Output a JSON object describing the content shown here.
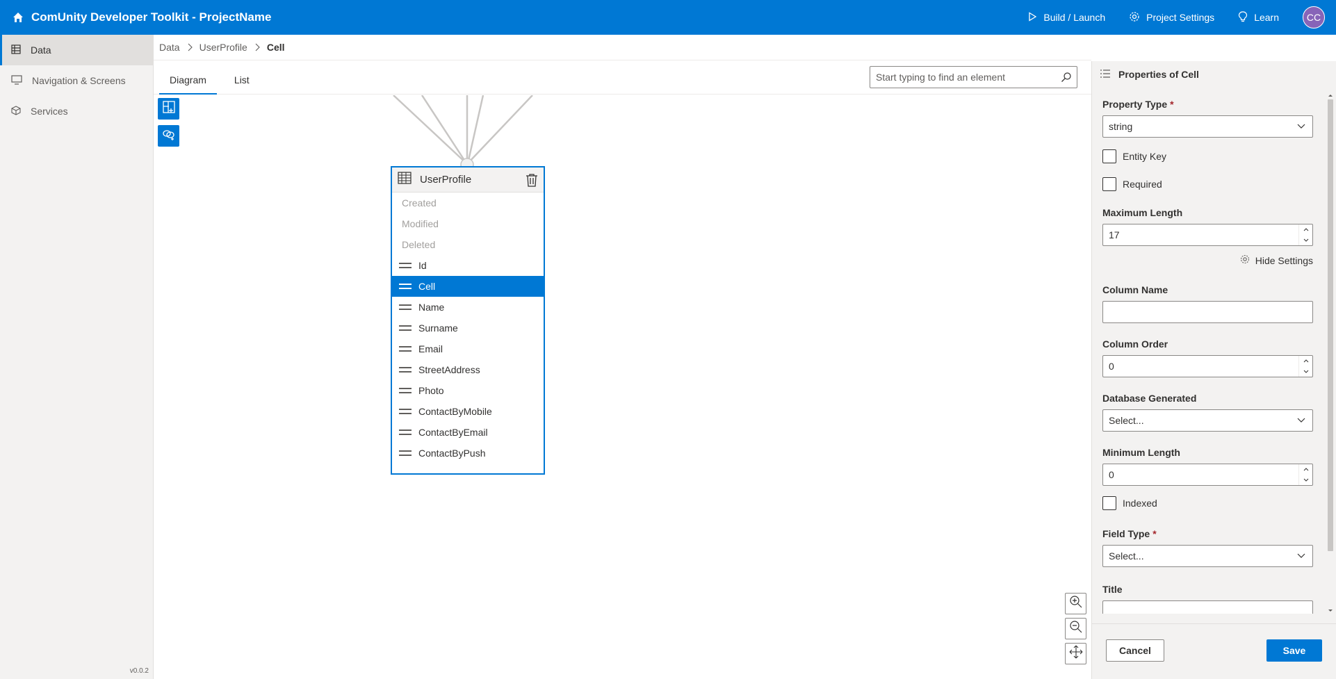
{
  "app": {
    "title": "ComUnity Developer Toolkit - ProjectName",
    "avatar": "CC",
    "version": "v0.0.2"
  },
  "topnav": [
    {
      "label": "Build / Launch",
      "icon": "play-icon"
    },
    {
      "label": "Project Settings",
      "icon": "gear-icon"
    },
    {
      "label": "Learn",
      "icon": "lightbulb-icon"
    }
  ],
  "sidebar": {
    "items": [
      {
        "label": "Data",
        "icon": "table-icon",
        "active": true
      },
      {
        "label": "Navigation & Screens",
        "icon": "screen-icon",
        "active": false
      },
      {
        "label": "Services",
        "icon": "cube-icon",
        "active": false
      }
    ]
  },
  "breadcrumb": [
    "Data",
    "UserProfile",
    "Cell"
  ],
  "tabs": [
    {
      "label": "Diagram",
      "active": true
    },
    {
      "label": "List",
      "active": false
    }
  ],
  "search": {
    "placeholder": "Start typing to find an element",
    "value": ""
  },
  "entity": {
    "title": "UserProfile",
    "system_fields": [
      "Created",
      "Modified",
      "Deleted"
    ],
    "fields": [
      "Id",
      "Cell",
      "Name",
      "Surname",
      "Email",
      "StreetAddress",
      "Photo",
      "ContactByMobile",
      "ContactByEmail",
      "ContactByPush"
    ],
    "selected_field": "Cell"
  },
  "panel": {
    "title": "Properties of Cell",
    "property_type": {
      "label": "Property Type",
      "required": true,
      "value": "string"
    },
    "entity_key": {
      "label": "Entity Key",
      "checked": false
    },
    "required": {
      "label": "Required",
      "checked": false
    },
    "maximum_length": {
      "label": "Maximum Length",
      "value": "17"
    },
    "hide_settings": "Hide Settings",
    "column_name": {
      "label": "Column Name",
      "value": ""
    },
    "column_order": {
      "label": "Column Order",
      "value": "0"
    },
    "database_generated": {
      "label": "Database Generated",
      "value": "Select..."
    },
    "minimum_length": {
      "label": "Minimum Length",
      "value": "0"
    },
    "indexed": {
      "label": "Indexed",
      "checked": false
    },
    "field_type": {
      "label": "Field Type",
      "required": true,
      "value": "Select..."
    },
    "title_field": {
      "label": "Title",
      "value": ""
    },
    "cancel": "Cancel",
    "save": "Save"
  },
  "colors": {
    "primary": "#0078d4",
    "avatar": "#8764b8",
    "sidebar": "#f3f2f1"
  }
}
